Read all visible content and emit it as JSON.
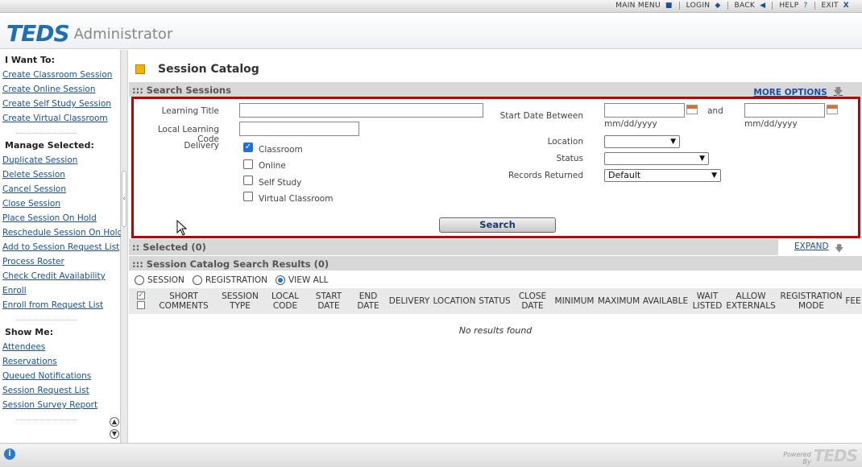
{
  "topnav": {
    "items": [
      {
        "label": "MAIN MENU",
        "icon": "■"
      },
      {
        "label": "LOGIN",
        "icon": "◆"
      },
      {
        "label": "BACK",
        "icon": "◀"
      },
      {
        "label": "HELP",
        "icon": "?"
      },
      {
        "label": "EXIT",
        "icon": "X"
      }
    ]
  },
  "header": {
    "logo": "TEDS",
    "app_name": "Administrator"
  },
  "sidebar": {
    "i_want_to": {
      "title": "I Want To:",
      "links": [
        "Create Classroom Session",
        "Create Online Session",
        "Create Self Study Session",
        "Create Virtual Classroom"
      ]
    },
    "manage_selected": {
      "title": "Manage Selected:",
      "links": [
        "Duplicate Session",
        "Delete Session",
        "Cancel Session",
        "Close Session",
        "Place Session On Hold",
        "Reschedule Session On Hold",
        "Add to Session Request List",
        "Process Roster",
        "Check Credit Availability",
        "Enroll",
        "Enroll from Request List"
      ]
    },
    "show_me": {
      "title": "Show Me:",
      "links": [
        "Attendees",
        "Reservations",
        "Queued Notifications",
        "Session Request List",
        "Session Survey Report"
      ]
    }
  },
  "main": {
    "page_title": "Session Catalog",
    "search_bar": {
      "title": "::: Search Sessions",
      "more_options": "MORE OPTIONS"
    },
    "form": {
      "learning_title_label": "Learning Title",
      "learning_title_value": "",
      "local_code_label": "Local Learning Code",
      "local_code_value": "",
      "delivery_label": "Delivery",
      "delivery_options": [
        {
          "label": "Classroom",
          "checked": true
        },
        {
          "label": "Online",
          "checked": false
        },
        {
          "label": "Self Study",
          "checked": false
        },
        {
          "label": "Virtual Classroom",
          "checked": false
        }
      ],
      "start_date_label": "Start Date Between",
      "and_label": "and",
      "date_hint": "mm/dd/yyyy",
      "start_date_from": "",
      "start_date_to": "",
      "location_label": "Location",
      "location_value": "",
      "status_label": "Status",
      "status_value": "",
      "records_label": "Records Returned",
      "records_value": "Default",
      "search_button": "Search"
    },
    "selected_bar": {
      "title": ":: Selected (0)",
      "expand": "EXPAND"
    },
    "results_bar": {
      "title": "::: Session Catalog Search Results (0)"
    },
    "view_options": [
      {
        "label": "SESSION",
        "selected": false
      },
      {
        "label": "REGISTRATION",
        "selected": false
      },
      {
        "label": "VIEW ALL",
        "selected": true
      }
    ],
    "columns": [
      "SHORT COMMENTS",
      "SESSION TYPE",
      "LOCAL CODE",
      "START DATE",
      "END DATE",
      "DELIVERY",
      "LOCATION",
      "STATUS",
      "CLOSE DATE",
      "MINIMUM",
      "MAXIMUM",
      "AVAILABLE",
      "WAIT LISTED",
      "ALLOW EXTERNALS",
      "REGISTRATION MODE",
      "FEE"
    ],
    "empty_message": "No results found"
  },
  "footer": {
    "powered_by_1": "Powered",
    "powered_by_2": "By",
    "brand": "TEDS"
  },
  "colors": {
    "accent": "#1a4fa0",
    "highlight_border": "#c00000",
    "bar": "#d8d8d8"
  }
}
